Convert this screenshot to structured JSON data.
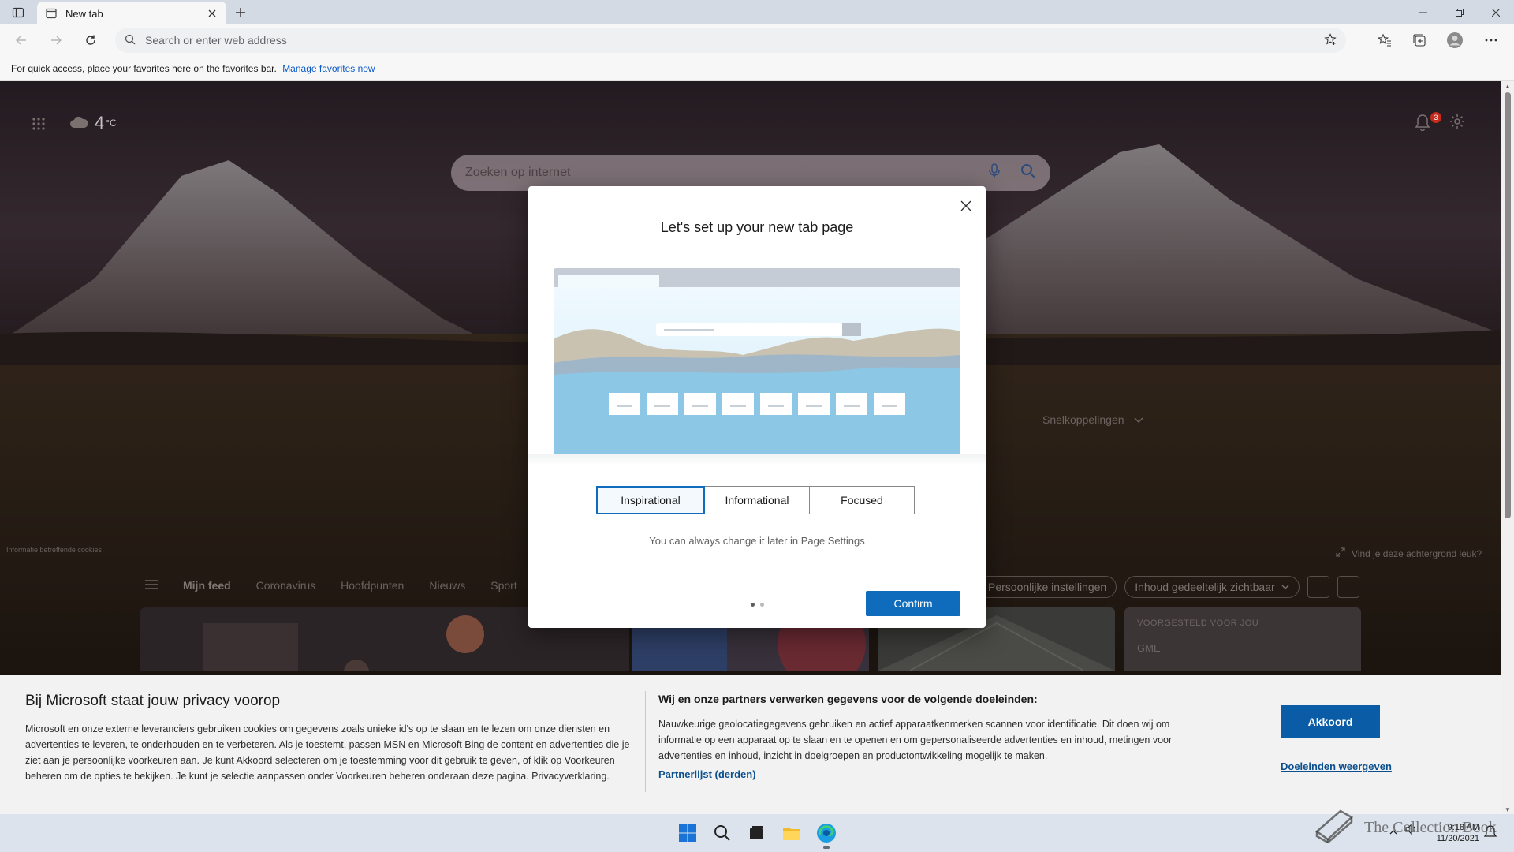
{
  "browser": {
    "tab_title": "New tab",
    "address_placeholder": "Search or enter web address",
    "favbar_text": "For quick access, place your favorites here on the favorites bar.",
    "favbar_link": "Manage favorites now"
  },
  "ntp": {
    "weather_temp": "4",
    "weather_unit": "°C",
    "notification_count": "3",
    "search_placeholder": "Zoeken op internet",
    "quicklinks_label": "Snelkoppelingen",
    "bg_info": "Informatie betreffende cookies",
    "bg_like": "Vind je deze achtergrond leuk?",
    "feed_tabs": [
      "Mijn feed",
      "Coronavirus",
      "Hoofdpunten",
      "Nieuws",
      "Sport"
    ],
    "feed_personal": "Persoonlijke instellingen",
    "feed_visibility": "Inhoud gedeeltelijk zichtbaar",
    "card_suggested_label": "VOORGESTELD VOOR JOU",
    "card_ticker": "GME"
  },
  "dialog": {
    "title": "Let's set up your new tab page",
    "modes": [
      "Inspirational",
      "Informational",
      "Focused"
    ],
    "selected_mode": "Inspirational",
    "hint": "You can always change it later in Page Settings",
    "confirm": "Confirm",
    "step_current": 1,
    "step_total": 2
  },
  "privacy": {
    "title": "Bij Microsoft staat jouw privacy voorop",
    "body": "Microsoft en onze externe leveranciers gebruiken cookies om gegevens zoals unieke id's op te slaan en te lezen om onze diensten en advertenties te leveren, te onderhouden en te verbeteren. Als je toestemt, passen MSN en Microsoft Bing de content en advertenties die je ziet aan je persoonlijke voorkeuren aan. Je kunt Akkoord selecteren om je toestemming voor dit gebruik te geven, of klik op Voorkeuren beheren om de opties te bekijken. Je kunt je selectie aanpassen onder Voorkeuren beheren onderaan deze pagina. Privacyverklaring.",
    "purposes_title": "Wij en onze partners verwerken gegevens voor de volgende doeleinden:",
    "purposes_body": "Nauwkeurige geolocatiegegevens gebruiken en actief apparaatkenmerken scannen voor identificatie. Dit doen wij om informatie op een apparaat op te slaan en te openen en om gepersonaliseerde advertenties en inhoud, metingen voor advertenties en inhoud, inzicht in doelgroepen en productontwikkeling mogelijk te maken.",
    "partners_link": "Partnerlijst (derden)",
    "accept": "Akkoord",
    "purposes_link": "Doeleinden weergeven"
  },
  "taskbar": {
    "time": "9:18 AM",
    "date": "11/20/2021",
    "watermark": "The Collection Book"
  },
  "colors": {
    "accent": "#0f6cbd",
    "privacy_button": "#0b5ca6",
    "link": "#0b4f8f"
  }
}
